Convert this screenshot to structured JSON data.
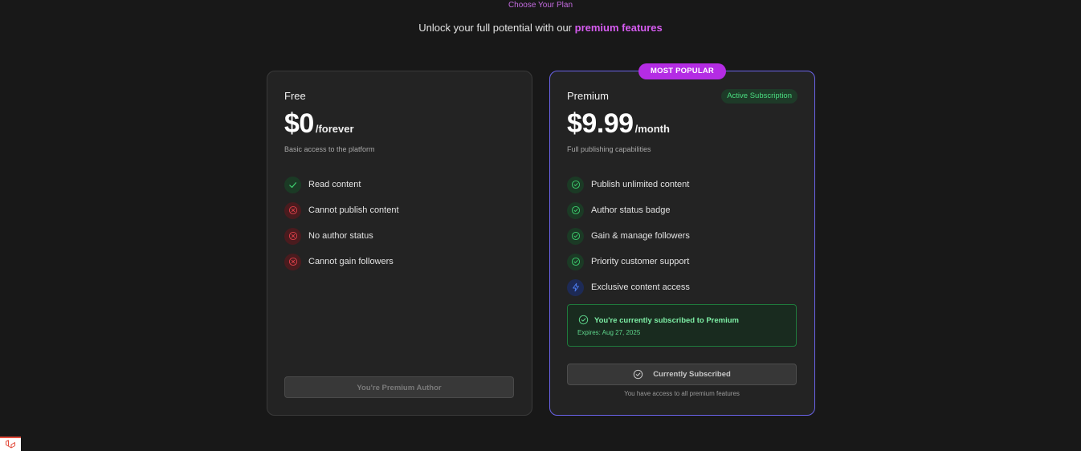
{
  "header": {
    "eyebrow": "Choose Your Plan",
    "subtitle_prefix": "Unlock your full potential with our",
    "subtitle_highlight": "premium features"
  },
  "plans": {
    "free": {
      "name": "Free",
      "price": "$0",
      "period": "/forever",
      "description": "Basic access to the platform",
      "features": [
        {
          "label": "Read content",
          "icon": "check-icon",
          "status": "included"
        },
        {
          "label": "Cannot publish content",
          "icon": "x-circle-icon",
          "status": "excluded"
        },
        {
          "label": "No author status",
          "icon": "x-circle-icon",
          "status": "excluded"
        },
        {
          "label": "Cannot gain followers",
          "icon": "x-circle-icon",
          "status": "excluded"
        }
      ],
      "button_label": "You're Premium Author",
      "button_disabled": true
    },
    "premium": {
      "badge": "MOST POPULAR",
      "name": "Premium",
      "active_label": "Active Subscription",
      "price": "$9.99",
      "period": "/month",
      "description": "Full publishing capabilities",
      "features": [
        {
          "label": "Publish unlimited content",
          "icon": "check-circle-icon",
          "status": "included"
        },
        {
          "label": "Author status badge",
          "icon": "check-circle-icon",
          "status": "included"
        },
        {
          "label": "Gain & manage followers",
          "icon": "check-circle-icon",
          "status": "included"
        },
        {
          "label": "Priority customer support",
          "icon": "check-circle-icon",
          "status": "included"
        },
        {
          "label": "Exclusive content access",
          "icon": "lightning-bolt-icon",
          "status": "included"
        }
      ],
      "subscription_notice": {
        "title": "You're currently subscribed to Premium",
        "expires": "Expires: Aug 27, 2025"
      },
      "button_label": "Currently Subscribed",
      "access_note": "You have access to all premium features"
    }
  },
  "colors": {
    "background": "#181818",
    "card": "#232323",
    "accent_purple": "#b42ce4",
    "premium_border": "#6a63e8",
    "success_green": "#4ade80",
    "error_red": "#e0404a"
  }
}
